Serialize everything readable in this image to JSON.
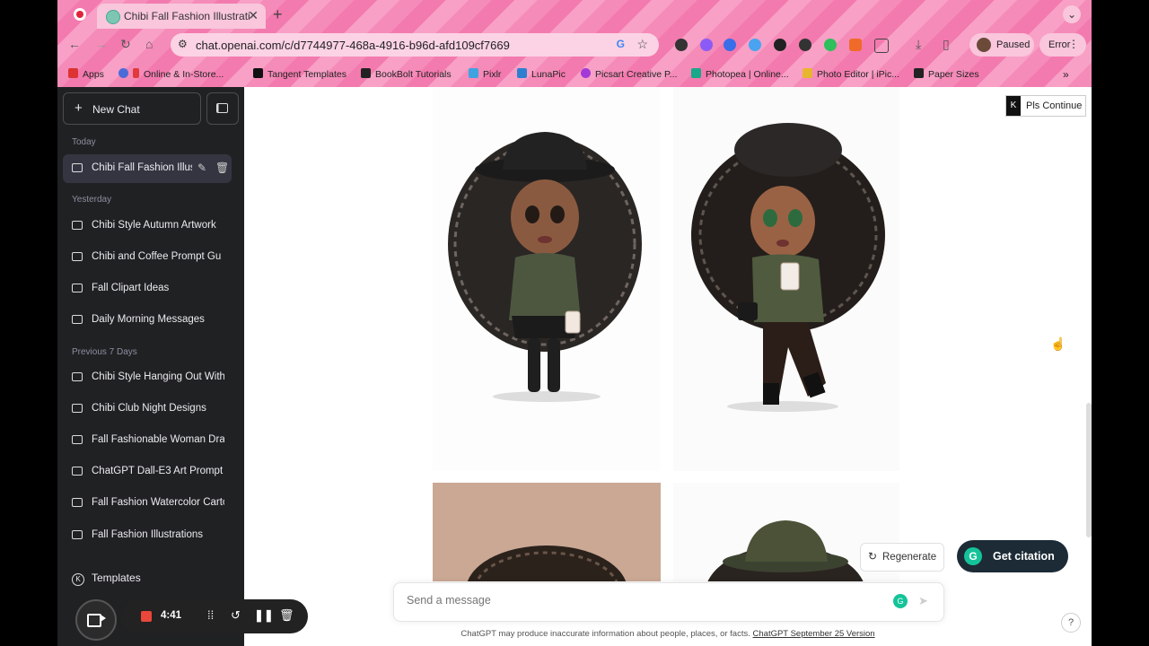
{
  "browser": {
    "tab_title": "Chibi Fall Fashion Illustration",
    "url": "chat.openai.com/c/d7744977-468a-4916-b96d-afd109cf7669",
    "profile_status": "Paused",
    "error_label": "Error",
    "bookmarks": [
      "Apps",
      "Online & In-Store...",
      "Tangent Templates",
      "BookBolt Tutorials",
      "Pixlr",
      "LunaPic",
      "Picsart Creative P...",
      "Photopea | Online...",
      "Photo Editor | iPic...",
      "Paper Sizes"
    ]
  },
  "sidebar": {
    "new_chat": "New Chat",
    "sections": {
      "today": "Today",
      "yesterday": "Yesterday",
      "previous": "Previous 7 Days"
    },
    "today_items": [
      "Chibi Fall Fashion Illus"
    ],
    "yesterday_items": [
      "Chibi Style Autumn Artwork",
      "Chibi and Coffee Prompt Gu",
      "Fall Clipart Ideas",
      "Daily Morning Messages"
    ],
    "previous_items": [
      "Chibi Style Hanging Out With",
      "Chibi Club Night Designs",
      "Fall Fashionable Woman Dra",
      "ChatGPT Dall-E3 Art Prompt",
      "Fall Fashion Watercolor Carto",
      "Fall Fashion Illustrations"
    ],
    "templates": "Templates"
  },
  "main": {
    "continue_label": "Pls Continue",
    "regenerate": "Regenerate",
    "get_citation": "Get citation",
    "composer_placeholder": "Send a message",
    "footer_text": "ChatGPT may produce inaccurate information about people, places, or facts.",
    "footer_link": "ChatGPT September 25 Version"
  },
  "recorder": {
    "time": "4:41"
  },
  "colors": {
    "sidebar_bg": "#202123",
    "chrome_pink": "#f58bb8",
    "citation_bg": "#1d2b36",
    "grammarly_green": "#15c39a"
  }
}
